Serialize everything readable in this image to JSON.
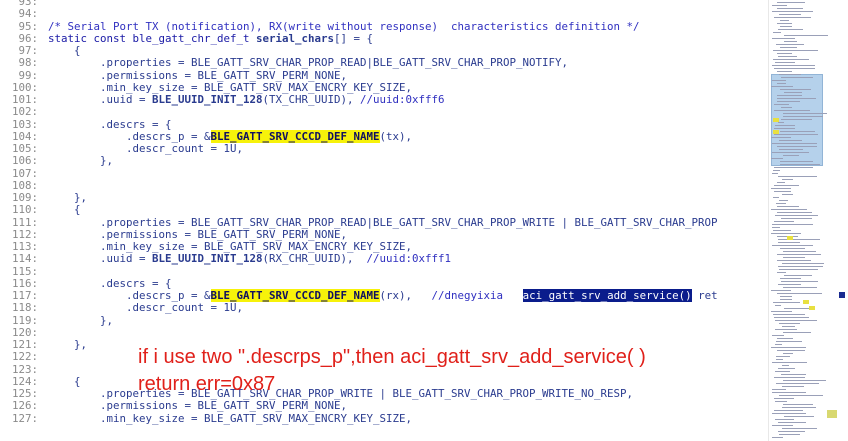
{
  "editor": {
    "lines": [
      {
        "n": "93:",
        "segs": [
          {
            "t": ""
          }
        ]
      },
      {
        "n": "94:",
        "segs": [
          {
            "t": ""
          }
        ]
      },
      {
        "n": "95:",
        "segs": [
          {
            "t": "/* Serial Port TX (notification), RX(write without response)  characteristics definition */",
            "c": "cm"
          }
        ]
      },
      {
        "n": "96:",
        "segs": [
          {
            "t": "static const ble_gatt_chr_def_t ",
            "c": "kw"
          },
          {
            "t": "serial_chars",
            "c": "bold"
          },
          {
            "t": "[] = {"
          }
        ]
      },
      {
        "n": "97:",
        "segs": [
          {
            "t": "    {"
          }
        ]
      },
      {
        "n": "98:",
        "segs": [
          {
            "t": "        .properties = BLE_GATT_SRV_CHAR_PROP_READ|BLE_GATT_SRV_CHAR_PROP_NOTIFY,"
          }
        ]
      },
      {
        "n": "99:",
        "segs": [
          {
            "t": "        .permissions = BLE_GATT_SRV_PERM_NONE,"
          }
        ]
      },
      {
        "n": "100:",
        "segs": [
          {
            "t": "        .min_key_size = BLE_GATT_SRV_MAX_ENCRY_KEY_SIZE,"
          }
        ]
      },
      {
        "n": "101:",
        "segs": [
          {
            "t": "        .uuid = "
          },
          {
            "t": "BLE_UUID_INIT_128",
            "c": "bold"
          },
          {
            "t": "(TX_CHR_UUID), "
          },
          {
            "t": "//uuid:0xfff6",
            "c": "cm"
          }
        ]
      },
      {
        "n": "102:",
        "segs": [
          {
            "t": ""
          }
        ]
      },
      {
        "n": "103:",
        "segs": [
          {
            "t": "        .descrs = {"
          }
        ]
      },
      {
        "n": "104:",
        "segs": [
          {
            "t": "            .descrs_p = &"
          },
          {
            "t": "BLE_GATT_SRV_CCCD_DEF_NAME",
            "c": "hl"
          },
          {
            "t": "(tx),"
          }
        ]
      },
      {
        "n": "105:",
        "segs": [
          {
            "t": "            .descr_count = 1U,"
          }
        ]
      },
      {
        "n": "106:",
        "segs": [
          {
            "t": "        },"
          }
        ]
      },
      {
        "n": "107:",
        "segs": [
          {
            "t": ""
          }
        ]
      },
      {
        "n": "108:",
        "segs": [
          {
            "t": ""
          }
        ]
      },
      {
        "n": "109:",
        "segs": [
          {
            "t": "    },"
          }
        ]
      },
      {
        "n": "110:",
        "segs": [
          {
            "t": "    {"
          }
        ]
      },
      {
        "n": "111:",
        "segs": [
          {
            "t": "        .properties = BLE_GATT_SRV_CHAR_PROP_READ|BLE_GATT_SRV_CHAR_PROP_WRITE | BLE_GATT_SRV_CHAR_PROP"
          }
        ]
      },
      {
        "n": "112:",
        "segs": [
          {
            "t": "        .permissions = BLE_GATT_SRV_PERM_NONE,"
          }
        ]
      },
      {
        "n": "113:",
        "segs": [
          {
            "t": "        .min_key_size = BLE_GATT_SRV_MAX_ENCRY_KEY_SIZE,"
          }
        ]
      },
      {
        "n": "114:",
        "segs": [
          {
            "t": "        .uuid = "
          },
          {
            "t": "BLE_UUID_INIT_128",
            "c": "bold"
          },
          {
            "t": "(RX_CHR_UUID),  "
          },
          {
            "t": "//uuid:0xfff1",
            "c": "cm"
          }
        ]
      },
      {
        "n": "115:",
        "segs": [
          {
            "t": ""
          }
        ]
      },
      {
        "n": "116:",
        "segs": [
          {
            "t": "        .descrs = {"
          }
        ]
      },
      {
        "n": "117:",
        "segs": [
          {
            "t": "            .descrs_p = &"
          },
          {
            "t": "BLE_GATT_SRV_CCCD_DEF_NAME",
            "c": "hl"
          },
          {
            "t": "(rx),   "
          },
          {
            "t": "//dnegyixia   ",
            "c": "cm"
          },
          {
            "t": "aci_gatt_srv_add_service()",
            "c": "sel"
          },
          {
            "t": " ret"
          }
        ]
      },
      {
        "n": "118:",
        "segs": [
          {
            "t": "            .descr_count = 1U,"
          }
        ]
      },
      {
        "n": "119:",
        "segs": [
          {
            "t": "        },"
          }
        ]
      },
      {
        "n": "120:",
        "segs": [
          {
            "t": ""
          }
        ]
      },
      {
        "n": "121:",
        "segs": [
          {
            "t": "    },"
          }
        ]
      },
      {
        "n": "122:",
        "segs": [
          {
            "t": ""
          }
        ]
      },
      {
        "n": "123:",
        "segs": [
          {
            "t": ""
          }
        ]
      },
      {
        "n": "124:",
        "segs": [
          {
            "t": "    {"
          }
        ]
      },
      {
        "n": "125:",
        "segs": [
          {
            "t": "        .properties = BLE_GATT_SRV_CHAR_PROP_WRITE | BLE_GATT_SRV_CHAR_PROP_WRITE_NO_RESP,"
          }
        ]
      },
      {
        "n": "126:",
        "segs": [
          {
            "t": "        .permissions = BLE_GATT_SRV_PERM_NONE,"
          }
        ]
      },
      {
        "n": "127:",
        "segs": [
          {
            "t": "        .min_key_size = BLE_GATT_SRV_MAX_ENCRY_KEY_SIZE,"
          }
        ]
      }
    ]
  },
  "annotation": {
    "line1": "if i use two \".descrps_p\",then aci_gatt_srv_add_service( )",
    "line2": "return err=0x87"
  },
  "colors": {
    "annotation": "#e0201a",
    "highlight": "#f7f20a",
    "selection": "#0a1c8c"
  }
}
